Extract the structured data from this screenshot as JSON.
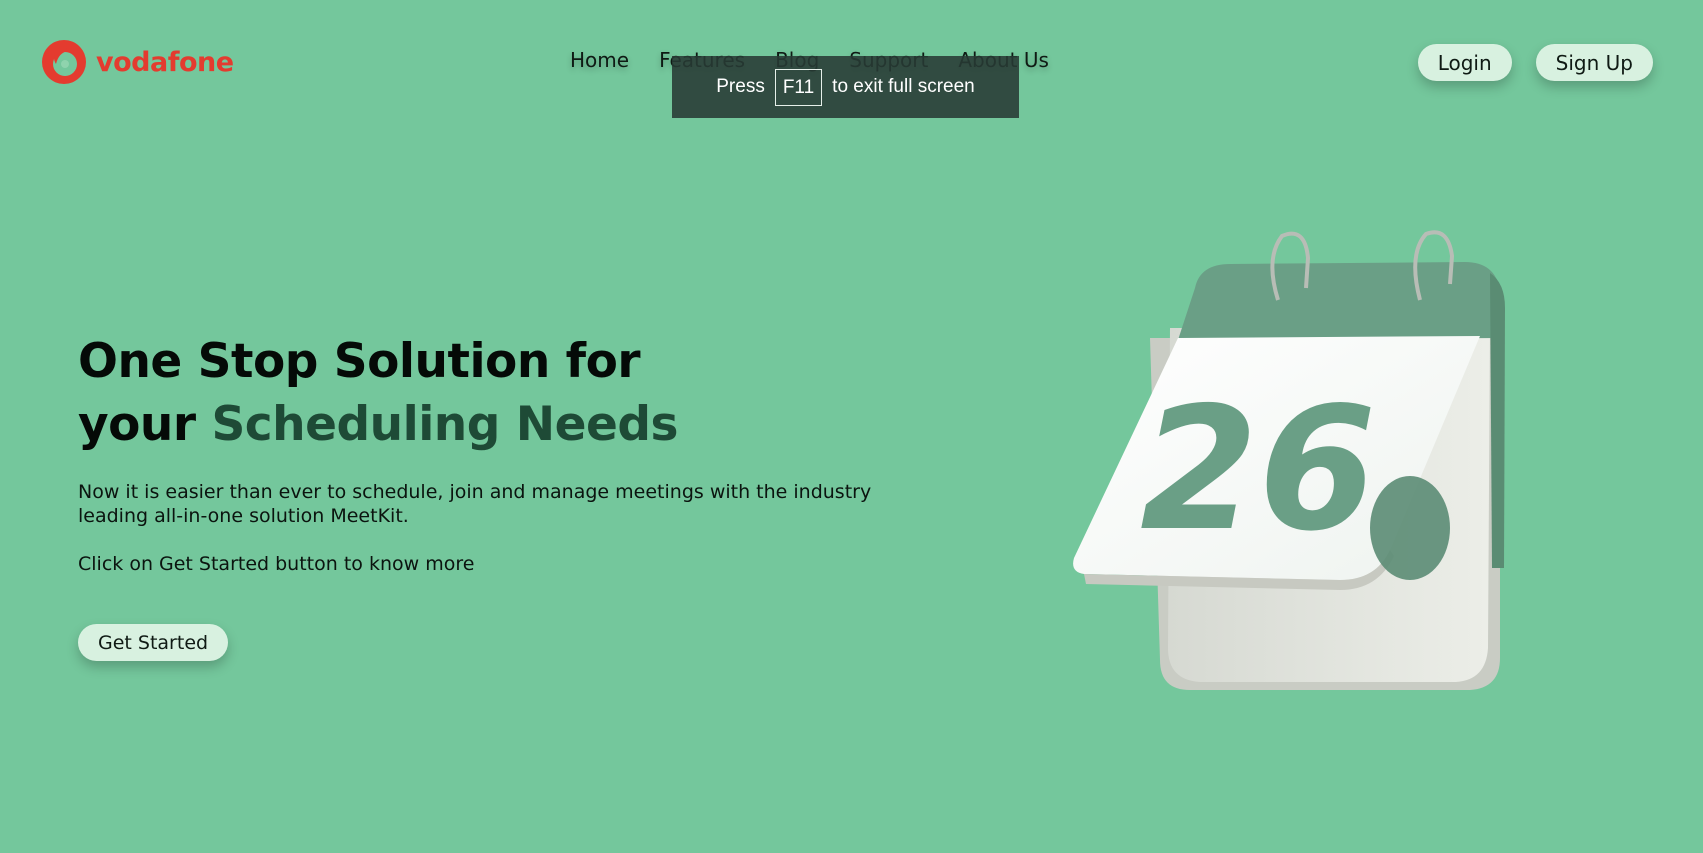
{
  "brand": {
    "name": "vodafone",
    "logo_icon": "vodafone-speechmark-icon",
    "color": "#e43b2f"
  },
  "nav": {
    "items": [
      "Home",
      "Features",
      "Blog",
      "Support",
      "About Us"
    ]
  },
  "auth": {
    "login": "Login",
    "signup": "Sign Up"
  },
  "fullscreen_toast": {
    "prefix": "Press",
    "key": "F11",
    "suffix": "to exit full screen"
  },
  "hero": {
    "title_line1": "One Stop Solution for",
    "title_line2_plain": "your ",
    "title_line2_accent": "Scheduling Needs",
    "description": "Now it is easier than ever to schedule, join and manage meetings with the industry leading all-in-one solution MeetKit.",
    "cta_text": "Click on Get Started button to know more",
    "button": "Get Started"
  },
  "illustration": {
    "icon": "calendar-icon",
    "day_number": "26"
  },
  "colors": {
    "background": "#74c79c",
    "accent_text": "#1e4a36",
    "pill": "#d8f1e0",
    "calendar_green": "#6aa087"
  }
}
